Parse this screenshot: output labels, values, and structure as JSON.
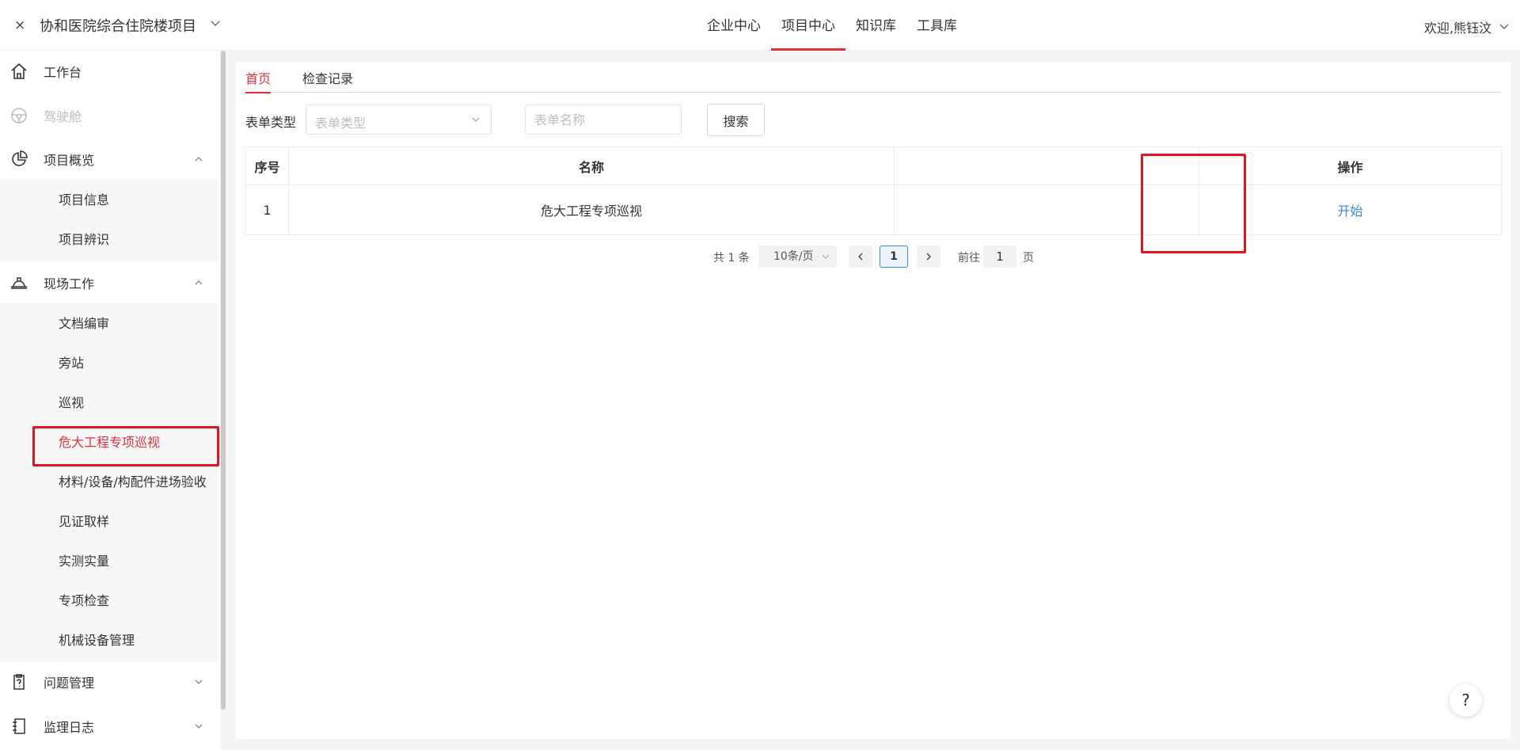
{
  "header": {
    "close_glyph": "×",
    "project_title": "协和医院综合住院楼项目",
    "nav": [
      {
        "label": "企业中心"
      },
      {
        "label": "项目中心"
      },
      {
        "label": "知识库"
      },
      {
        "label": "工具库"
      }
    ],
    "active_nav": "项目中心",
    "welcome": "欢迎,熊钰汶"
  },
  "sidebar": {
    "menu": {
      "workbench": "工作台",
      "cockpit": "驾驶舱",
      "overview": "项目概览",
      "fieldwork": "现场工作",
      "issues": "问题管理",
      "log": "监理日志"
    },
    "overview_items": [
      "项目信息",
      "项目辨识"
    ],
    "fieldwork_items": [
      "文档编审",
      "旁站",
      "巡视",
      "危大工程专项巡视",
      "材料/设备/构配件进场验收",
      "见证取样",
      "实测实量",
      "专项检查",
      "机械设备管理"
    ],
    "active_item": "危大工程专项巡视"
  },
  "main": {
    "tabs": [
      "首页",
      "检查记录"
    ],
    "filter": {
      "type_label": "表单类型",
      "type_placeholder": "表单类型",
      "name_placeholder": "表单名称",
      "search_label": "搜索"
    },
    "table": {
      "headers": [
        "序号",
        "名称",
        "",
        "操作"
      ],
      "rows": [
        {
          "index": "1",
          "name": "危大工程专项巡视",
          "action": "开始"
        }
      ]
    },
    "pagination": {
      "total": "共 1 条",
      "page_size": "10条/页",
      "current": "1",
      "goto_label": "前往",
      "goto_value": "1",
      "page_suffix": "页"
    }
  },
  "help": "?",
  "colors": {
    "accent": "#e0303a",
    "link": "#3a86d6",
    "highlight_box": "#e3141d"
  }
}
